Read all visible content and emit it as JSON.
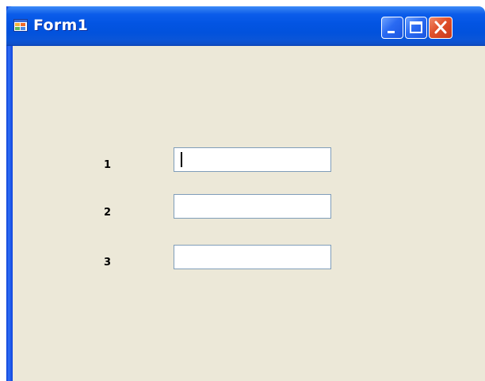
{
  "window": {
    "title": "Form1",
    "app_icon": "form-app-icon",
    "controls": [
      "minimize-icon",
      "maximize-icon",
      "close-icon"
    ]
  },
  "form": {
    "fields": [
      {
        "label": "1",
        "value": "",
        "focused": true
      },
      {
        "label": "2",
        "value": "",
        "focused": false
      },
      {
        "label": "3",
        "value": "",
        "focused": false
      }
    ]
  },
  "colors": {
    "titlebar": "#0354e2",
    "client_background": "#ece8d8",
    "textbox_border": "#7f9db9",
    "close_button": "#e0502a"
  }
}
